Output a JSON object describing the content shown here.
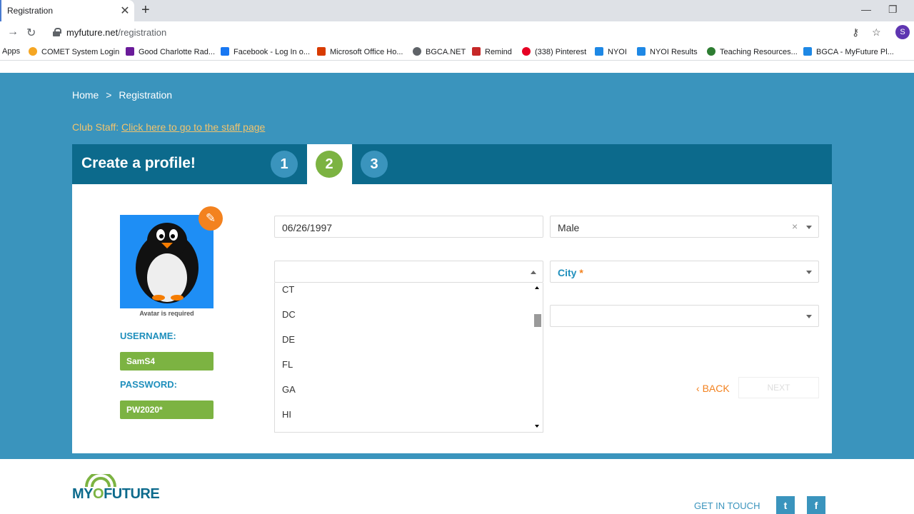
{
  "browser": {
    "tab_title": "Registration",
    "tab_close": "✕",
    "new_tab": "+",
    "url_host": "myfuture.net",
    "url_path": "/registration",
    "profile_initial": "S",
    "bookmarks": [
      {
        "label": "Apps",
        "icon_color": "#4285f4",
        "icon": "apps-icon"
      },
      {
        "label": "COMET System Login",
        "icon_color": "#f5a623",
        "icon": "comet-icon"
      },
      {
        "label": "Good Charlotte Rad...",
        "icon_color": "#6a1b9a",
        "icon": "podcast-icon"
      },
      {
        "label": "Facebook - Log In o...",
        "icon_color": "#1877f2",
        "icon": "facebook-icon"
      },
      {
        "label": "Microsoft Office Ho...",
        "icon_color": "#d83b01",
        "icon": "office-icon"
      },
      {
        "label": "BGCA.NET",
        "icon_color": "#5f6368",
        "icon": "globe-icon"
      },
      {
        "label": "Remind",
        "icon_color": "#c62828",
        "icon": "remind-icon"
      },
      {
        "label": "(338) Pinterest",
        "icon_color": "#e60023",
        "icon": "pinterest-icon"
      },
      {
        "label": "NYOI",
        "icon_color": "#1e88e5",
        "icon": "nyoi-icon"
      },
      {
        "label": "NYOI Results",
        "icon_color": "#1e88e5",
        "icon": "nyoi-icon"
      },
      {
        "label": "Teaching Resources...",
        "icon_color": "#2e7d32",
        "icon": "teaching-icon"
      },
      {
        "label": "BGCA - MyFuture Pl...",
        "icon_color": "#1e88e5",
        "icon": "myfuture-icon"
      }
    ]
  },
  "breadcrumb": {
    "home": "Home",
    "separator": ">",
    "current": "Registration"
  },
  "staff": {
    "prefix": "Club Staff:",
    "link": "Click here to go to the staff page"
  },
  "card": {
    "title": "Create a profile!",
    "steps": [
      {
        "label": "1",
        "color": "#3a94bd"
      },
      {
        "label": "2",
        "color": "#7cb342"
      },
      {
        "label": "3",
        "color": "#3a94bd"
      }
    ]
  },
  "profile": {
    "avatar_required": "Avatar is required",
    "username_label": "USERNAME:",
    "username": "SamS4",
    "password_label": "PASSWORD:",
    "password": "PW2020*"
  },
  "form": {
    "birthdate": "06/26/1997",
    "gender": "Male",
    "clear": "×",
    "city_label": "City",
    "city_required": "*",
    "state_options": [
      "CT",
      "DC",
      "DE",
      "FL",
      "GA",
      "HI"
    ]
  },
  "actions": {
    "back": "BACK",
    "back_icon": "‹",
    "next": "NEXT"
  },
  "footer": {
    "logo_my": "MY",
    "logo_o": "O",
    "logo_future": "FUTURE",
    "get_in_touch": "GET IN TOUCH",
    "twitter_glyph": "t",
    "facebook_glyph": "f"
  },
  "colors": {
    "primary": "#3a94bd",
    "header": "#0c6a8c",
    "accent": "#f3821f",
    "green": "#7cb342"
  }
}
